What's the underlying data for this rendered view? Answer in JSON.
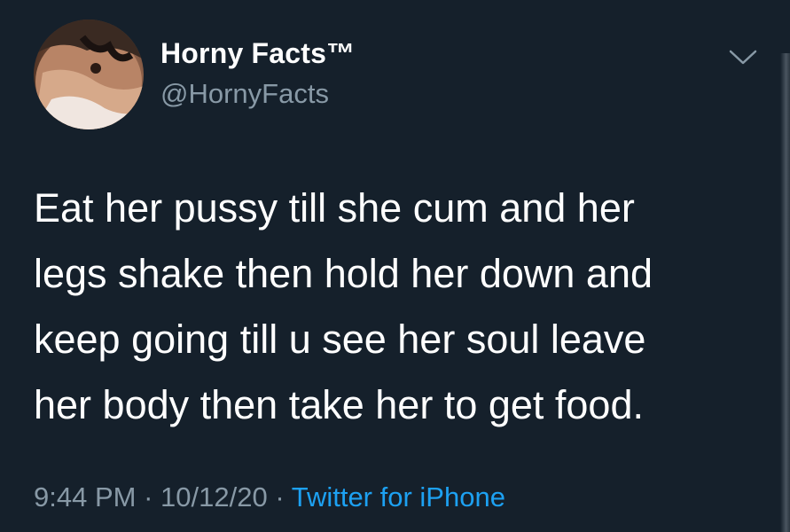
{
  "tweet": {
    "display_name": "Horny Facts™",
    "handle": "@HornyFacts",
    "text_lines": [
      "Eat her pussy till she cum and her",
      "legs shake then hold her down and",
      "keep going till u see her soul leave",
      "her body then take her to get food."
    ],
    "time": "9:44 PM",
    "date": "10/12/20",
    "separator": "·",
    "source": "Twitter for iPhone"
  },
  "icons": {
    "avatar": "profile-photo",
    "menu": "chevron-down-icon"
  },
  "colors": {
    "background": "#15202b",
    "text_primary": "#ffffff",
    "text_secondary": "#8899a6",
    "link": "#1da1f2"
  }
}
